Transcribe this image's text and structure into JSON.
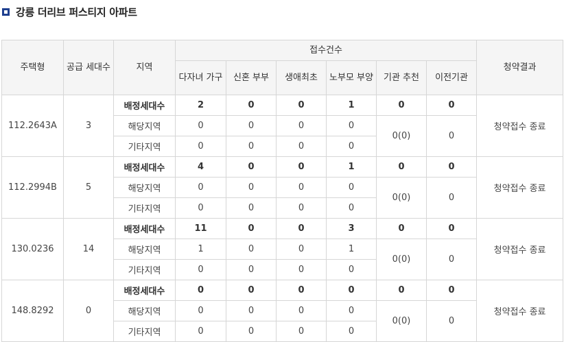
{
  "page": {
    "title": "강릉 더리브 퍼스티지 아파트"
  },
  "table": {
    "headers": {
      "housing_type": "주택형",
      "supply_units": "공급 세대수",
      "region": "지역",
      "applications": "접수건수",
      "result": "청약결과"
    },
    "sub_headers": [
      "다자녀 가구",
      "신혼 부부",
      "생애최초",
      "노부모 부양",
      "기관 추천",
      "이전기관"
    ],
    "region_labels": {
      "assigned": "배정세대수",
      "local": "해당지역",
      "other": "기타지역"
    },
    "groups": [
      {
        "type": "112.2643A",
        "supply": "3",
        "result": "청약접수 종료",
        "assigned": [
          "2",
          "0",
          "0",
          "1",
          "0",
          "0"
        ],
        "local": [
          "0",
          "0",
          "0",
          "0"
        ],
        "other": [
          "0",
          "0",
          "0",
          "0"
        ],
        "institution": "0(0)",
        "relocated": "0"
      },
      {
        "type": "112.2994B",
        "supply": "5",
        "result": "청약접수 종료",
        "assigned": [
          "4",
          "0",
          "0",
          "1",
          "0",
          "0"
        ],
        "local": [
          "0",
          "0",
          "0",
          "0"
        ],
        "other": [
          "0",
          "0",
          "0",
          "0"
        ],
        "institution": "0(0)",
        "relocated": "0"
      },
      {
        "type": "130.0236",
        "supply": "14",
        "result": "청약접수 종료",
        "assigned": [
          "11",
          "0",
          "0",
          "3",
          "0",
          "0"
        ],
        "local": [
          "1",
          "0",
          "0",
          "1"
        ],
        "other": [
          "0",
          "0",
          "0",
          "0"
        ],
        "institution": "0(0)",
        "relocated": "0"
      },
      {
        "type": "148.8292",
        "supply": "0",
        "result": "청약접수 종료",
        "assigned": [
          "0",
          "0",
          "0",
          "0",
          "0",
          "0"
        ],
        "local": [
          "0",
          "0",
          "0",
          "0"
        ],
        "other": [
          "0",
          "0",
          "0",
          "0"
        ],
        "institution": "0(0)",
        "relocated": "0"
      }
    ]
  }
}
